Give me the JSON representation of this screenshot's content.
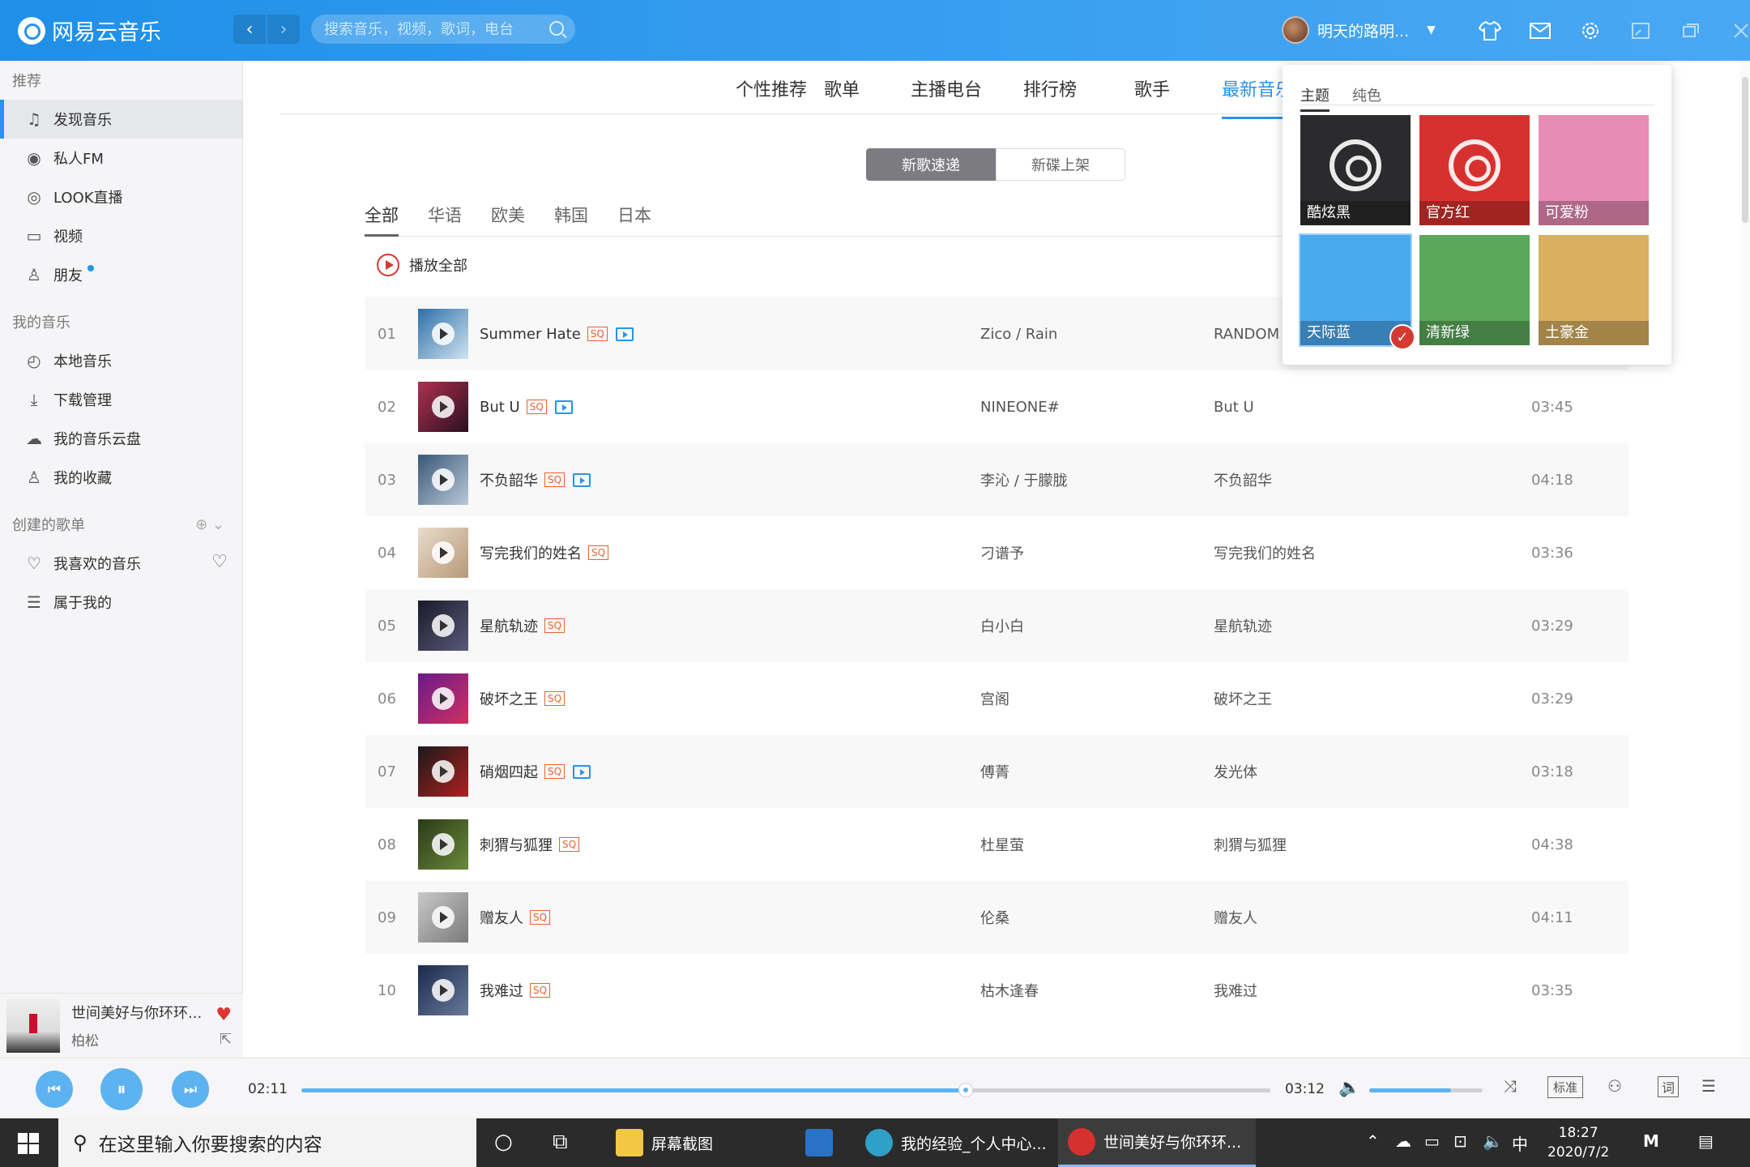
{
  "app": {
    "title": "网易云音乐",
    "search_placeholder": "搜索音乐，视频，歌词，电台",
    "user_name": "明天的路明...",
    "back": "‹",
    "forward": "›",
    "caret": "▼"
  },
  "title_icons": [
    "skin-icon",
    "mail-icon",
    "gear-icon",
    "mini-mode-icon",
    "minimize-icon",
    "maximize-icon",
    "close-icon"
  ],
  "sidebar": {
    "recommend_header": "推荐",
    "recommend": [
      "发现音乐",
      "私人FM",
      "LOOK直播",
      "视频",
      "朋友"
    ],
    "my_music_header": "我的音乐",
    "my_music": [
      "本地音乐",
      "下载管理",
      "我的音乐云盘",
      "我的收藏"
    ],
    "created_header": "创建的歌单",
    "created": [
      "我喜欢的音乐",
      "属于我的"
    ]
  },
  "now_playing": {
    "title": "世间美好与你环环...",
    "artist": "柏松"
  },
  "main": {
    "tabs": [
      "个性推荐",
      "歌单",
      "主播电台",
      "排行榜",
      "歌手",
      "最新音乐"
    ],
    "segment": [
      "新歌速递",
      "新碟上架"
    ],
    "langs": [
      "全部",
      "华语",
      "欧美",
      "韩国",
      "日本"
    ],
    "play_all": "播放全部",
    "songs": [
      {
        "num": "01",
        "title": "Summer Hate",
        "artist": "Zico / Rain",
        "album": "RANDOM",
        "dur": "",
        "mv": true,
        "c1": "#2d6fa8",
        "c2": "#cfe3f0"
      },
      {
        "num": "02",
        "title": "But U",
        "artist": "NINEONE#",
        "album": "But U",
        "dur": "03:45",
        "mv": true,
        "c1": "#b03050",
        "c2": "#2a1020"
      },
      {
        "num": "03",
        "title": "不负韶华",
        "artist": "李沁 / 于朦胧",
        "album": "不负韶华",
        "dur": "04:18",
        "mv": true,
        "c1": "#3a5878",
        "c2": "#b8c8d8"
      },
      {
        "num": "04",
        "title": "写完我们的姓名",
        "artist": "刁谱予",
        "album": "写完我们的姓名",
        "dur": "03:36",
        "mv": false,
        "c1": "#e8dccc",
        "c2": "#b89878"
      },
      {
        "num": "05",
        "title": "星航轨迹",
        "artist": "白小白",
        "album": "星航轨迹",
        "dur": "03:29",
        "mv": false,
        "c1": "#1a1a2a",
        "c2": "#5a5a7a"
      },
      {
        "num": "06",
        "title": "破坏之王",
        "artist": "宫阁",
        "album": "破坏之王",
        "dur": "03:29",
        "mv": false,
        "c1": "#6a1a8a",
        "c2": "#d03060"
      },
      {
        "num": "07",
        "title": "硝烟四起",
        "artist": "傅菁",
        "album": "发光体",
        "dur": "03:18",
        "mv": true,
        "c1": "#1a1a1a",
        "c2": "#b02020"
      },
      {
        "num": "08",
        "title": "刺猬与狐狸",
        "artist": "杜星萤",
        "album": "刺猬与狐狸",
        "dur": "04:38",
        "mv": false,
        "c1": "#2a3a1a",
        "c2": "#6a8a3a"
      },
      {
        "num": "09",
        "title": "赠友人",
        "artist": "伦桑",
        "album": "赠友人",
        "dur": "04:11",
        "mv": false,
        "c1": "#c8c8c8",
        "c2": "#7a7a7a"
      },
      {
        "num": "10",
        "title": "我难过",
        "artist": "枯木逢春",
        "album": "我难过",
        "dur": "03:35",
        "mv": false,
        "c1": "#1a2a4a",
        "c2": "#6a7a9a"
      }
    ],
    "sq_label": "SQ"
  },
  "skin_popup": {
    "tabs": [
      "主题",
      "纯色"
    ],
    "themes": [
      {
        "name": "酷炫黑",
        "bg": "#2b2b2d",
        "logo": true
      },
      {
        "name": "官方红",
        "bg": "#d7312f",
        "logo": true
      },
      {
        "name": "可爱粉",
        "bg": "#e88bb5",
        "logo": false
      },
      {
        "name": "天际蓝",
        "bg": "#4aaaf0",
        "logo": false,
        "selected": true
      },
      {
        "name": "清新绿",
        "bg": "#5aa85a",
        "logo": false
      },
      {
        "name": "土豪金",
        "bg": "#d8b060",
        "logo": false
      }
    ],
    "check": "✓"
  },
  "player": {
    "current": "02:11",
    "total": "03:12",
    "progress": 0.686,
    "volume": 0.72,
    "quality": "标准",
    "prev": "⏮",
    "pause": "⏸",
    "next": "⏭",
    "lyric": "词"
  },
  "taskbar": {
    "search_placeholder": "在这里输入你要搜索的内容",
    "apps": [
      {
        "label": "屏幕截图",
        "color": "#f2c744"
      },
      {
        "label": "",
        "color": "#2a72c8"
      },
      {
        "label": "我的经验_个人中心...",
        "color": "#2fa0c8"
      },
      {
        "label": "世间美好与你环环...",
        "color": "#d7312f"
      }
    ],
    "ime": "中",
    "time": "18:27",
    "date": "2020/7/2"
  }
}
